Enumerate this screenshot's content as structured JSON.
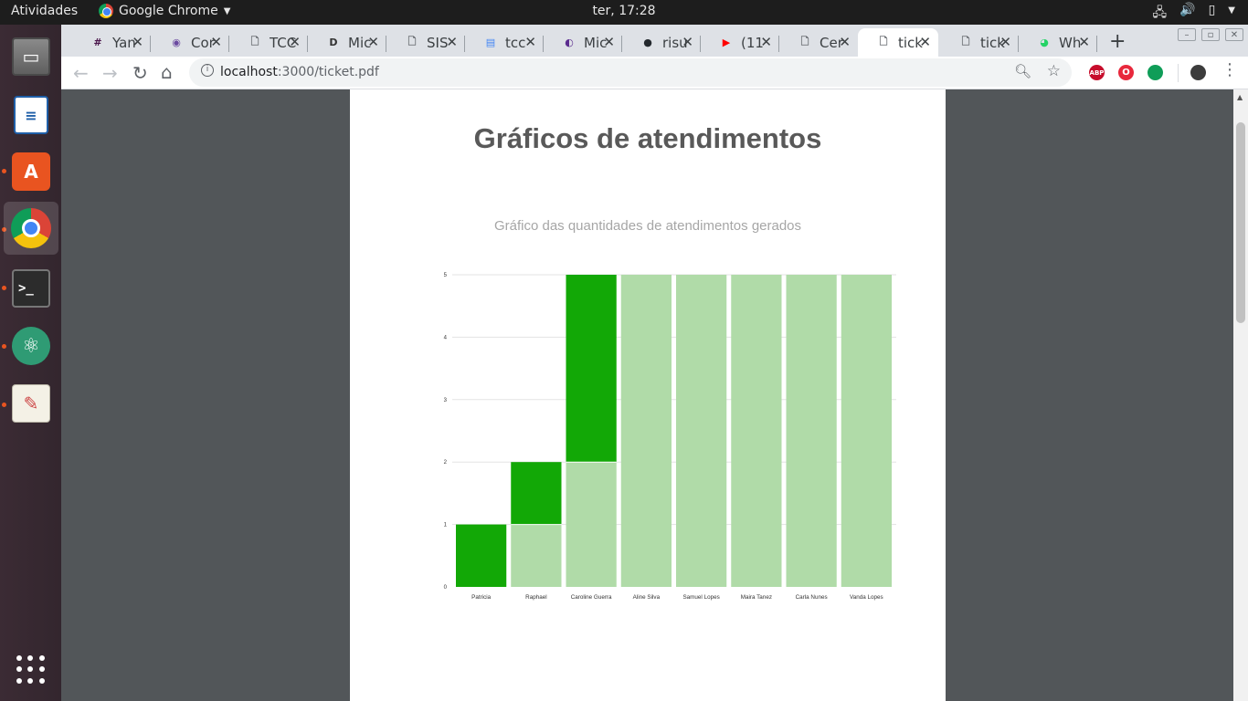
{
  "topbar": {
    "activities": "Atividades",
    "app_name": "Google Chrome",
    "clock": "ter, 17:28"
  },
  "dock": {
    "items": [
      "files-icon",
      "libreoffice-writer-icon",
      "ubuntu-software-icon",
      "google-chrome-icon",
      "terminal-icon",
      "atom-icon",
      "text-editor-icon"
    ],
    "show_apps": "show-applications-icon"
  },
  "tabs": [
    {
      "title": "Yan",
      "icon": "hash-icon",
      "color": "#4a154b"
    },
    {
      "title": "Cor",
      "icon": "ring-icon",
      "color": "#6b4aa0"
    },
    {
      "title": "TCC",
      "icon": "document-icon",
      "color": "#5f6368"
    },
    {
      "title": "Mic",
      "icon": "d-logo-icon",
      "color": "#333333"
    },
    {
      "title": "SIS",
      "icon": "document-icon",
      "color": "#5f6368"
    },
    {
      "title": "tcc",
      "icon": "docs-icon",
      "color": "#4285f4"
    },
    {
      "title": "Mic",
      "icon": "globe-icon",
      "color": "#5b2c8f"
    },
    {
      "title": "risu",
      "icon": "github-icon",
      "color": "#24292e"
    },
    {
      "title": "(11",
      "icon": "youtube-icon",
      "color": "#ff0000"
    },
    {
      "title": "Cer",
      "icon": "document-icon",
      "color": "#5f6368"
    },
    {
      "title": "tick",
      "icon": "document-icon",
      "color": "#5f6368",
      "active": true
    },
    {
      "title": "tick",
      "icon": "document-icon",
      "color": "#5f6368"
    },
    {
      "title": "Wh",
      "icon": "whatsapp-icon",
      "color": "#25d366"
    }
  ],
  "address": {
    "host": "localhost",
    "path": ":3000/ticket.pdf"
  },
  "extensions": [
    {
      "name": "adblock-plus-icon",
      "label": "ABP",
      "color": "#c70d2c"
    },
    {
      "name": "opera-icon",
      "label": "O",
      "color": "#e8283c"
    },
    {
      "name": "hangouts-icon",
      "label": "",
      "color": "#0f9d58"
    }
  ],
  "pdf": {
    "title": "Gráficos de atendimentos",
    "chart_title": "Gráfico das quantidades de atendimentos gerados"
  },
  "chart_data": {
    "type": "bar",
    "stacked": true,
    "categories": [
      "Patricia",
      "Raphael",
      "Caroline Guerra",
      "Aline Silva",
      "Samuel Lopes",
      "Maira Tanez",
      "Carla Nunes",
      "Vanda Lopes"
    ],
    "series": [
      {
        "values": [
          0,
          1,
          2,
          5,
          5,
          5,
          5,
          5
        ],
        "color": "#b0dba8"
      },
      {
        "values": [
          1,
          1,
          3,
          0,
          0,
          0,
          0,
          0
        ],
        "color": "#12a806"
      }
    ],
    "yticks": [
      "0",
      "1",
      "2",
      "3",
      "4",
      "5"
    ],
    "ylim": [
      0,
      5
    ],
    "grid": true
  }
}
